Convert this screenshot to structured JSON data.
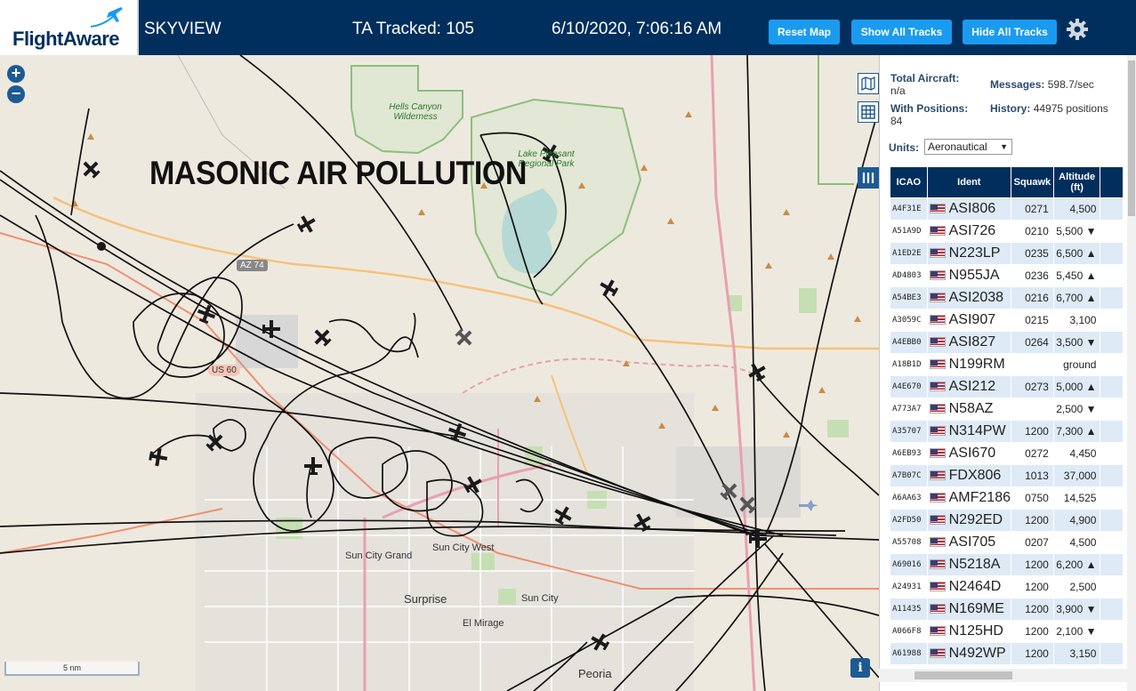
{
  "header": {
    "logo_text": "FlightAware",
    "app_title": "SKYVIEW",
    "tracked": "TA Tracked: 105",
    "datetime": "6/10/2020, 7:06:16 AM",
    "btn_reset": "Reset Map",
    "btn_show": "Show All Tracks",
    "btn_hide": "Hide All Tracks",
    "accent_color": "#1a9bf0",
    "bar_color": "#002f5d"
  },
  "map": {
    "overlay_text": "MASONIC AIR POLLUTION",
    "zoom_in": "+",
    "zoom_out": "−",
    "scale": "5 nm",
    "info": "i",
    "labels": {
      "hells_canyon": "Hells Canyon Wilderness",
      "lake_pleasant": "Lake Pleasant Regional Park",
      "az74": "AZ 74",
      "us60": "US 60",
      "sun_city_grand": "Sun City Grand",
      "sun_city_west": "Sun City West",
      "sun_city": "Sun City",
      "surprise": "Surprise",
      "el_mirage": "El Mirage",
      "peoria": "Peoria"
    }
  },
  "stats": {
    "total_label": "Total Aircraft:",
    "total_value": "n/a",
    "positions_label": "With Positions:",
    "positions_value": "84",
    "messages_label": "Messages:",
    "messages_value": "598.7/sec",
    "history_label": "History:",
    "history_value": "44975 positions",
    "units_label": "Units:",
    "units_value": "Aeronautical"
  },
  "table": {
    "headers": [
      "ICAO",
      "Ident",
      "Squawk",
      "Altitude (ft)"
    ],
    "rows": [
      {
        "icao": "A4F31E",
        "ident": "ASI806",
        "squawk": "0271",
        "alt": "4,500"
      },
      {
        "icao": "A51A9D",
        "ident": "ASI726",
        "squawk": "0210",
        "alt": "5,500 ▼"
      },
      {
        "icao": "A1ED2E",
        "ident": "N223LP",
        "squawk": "0235",
        "alt": "6,500 ▲"
      },
      {
        "icao": "AD4803",
        "ident": "N955JA",
        "squawk": "0236",
        "alt": "5,450 ▲"
      },
      {
        "icao": "A54BE3",
        "ident": "ASI2038",
        "squawk": "0216",
        "alt": "6,700 ▲"
      },
      {
        "icao": "A3059C",
        "ident": "ASI907",
        "squawk": "0215",
        "alt": "3,100"
      },
      {
        "icao": "A4EBB0",
        "ident": "ASI827",
        "squawk": "0264",
        "alt": "3,500 ▼"
      },
      {
        "icao": "A18B1D",
        "ident": "N199RM",
        "squawk": "",
        "alt": "ground"
      },
      {
        "icao": "A4E670",
        "ident": "ASI212",
        "squawk": "0273",
        "alt": "5,000 ▲"
      },
      {
        "icao": "A773A7",
        "ident": "N58AZ",
        "squawk": "",
        "alt": "2,500 ▼"
      },
      {
        "icao": "A35707",
        "ident": "N314PW",
        "squawk": "1200",
        "alt": "7,300 ▲"
      },
      {
        "icao": "A6EB93",
        "ident": "ASI670",
        "squawk": "0272",
        "alt": "4,450"
      },
      {
        "icao": "A7B07C",
        "ident": "FDX806",
        "squawk": "1013",
        "alt": "37,000"
      },
      {
        "icao": "A6AA63",
        "ident": "AMF2186",
        "squawk": "0750",
        "alt": "14,525"
      },
      {
        "icao": "A2FD50",
        "ident": "N292ED",
        "squawk": "1200",
        "alt": "4,900"
      },
      {
        "icao": "A55708",
        "ident": "ASI705",
        "squawk": "0207",
        "alt": "4,500"
      },
      {
        "icao": "A69016",
        "ident": "N5218A",
        "squawk": "1200",
        "alt": "6,200 ▲"
      },
      {
        "icao": "A24931",
        "ident": "N2464D",
        "squawk": "1200",
        "alt": "2,500"
      },
      {
        "icao": "A11435",
        "ident": "N169ME",
        "squawk": "1200",
        "alt": "3,900 ▼"
      },
      {
        "icao": "A066F8",
        "ident": "N125HD",
        "squawk": "1200",
        "alt": "2,100 ▼"
      },
      {
        "icao": "A61988",
        "ident": "N492WP",
        "squawk": "1200",
        "alt": "3,150"
      }
    ]
  }
}
